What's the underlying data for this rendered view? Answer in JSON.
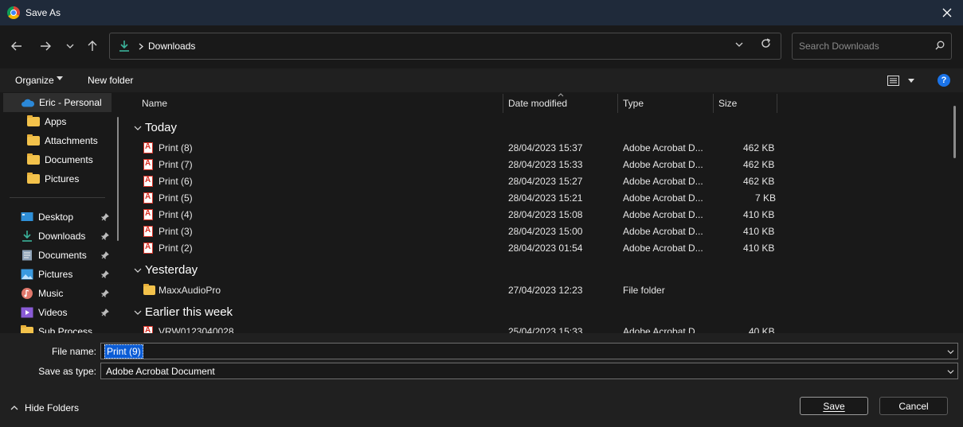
{
  "window": {
    "title": "Save As",
    "close_glyph": "✕"
  },
  "nav": {
    "back_icon": "arrow-left-icon",
    "forward_icon": "arrow-right-icon",
    "recent_icon": "chevron-down-icon",
    "up_icon": "arrow-up-icon",
    "breadcrumb": "Downloads",
    "search_placeholder": "Search Downloads"
  },
  "toolbar": {
    "organize": "Organize",
    "new_folder": "New folder",
    "help": "?"
  },
  "sidebar": {
    "onedrive": {
      "label": "Eric - Personal",
      "children": [
        "Apps",
        "Attachments",
        "Documents",
        "Pictures"
      ]
    },
    "quick_access": [
      {
        "label": "Desktop",
        "icon": "desktop-icon",
        "pinned": true
      },
      {
        "label": "Downloads",
        "icon": "downloads-icon",
        "pinned": true
      },
      {
        "label": "Documents",
        "icon": "documents-icon",
        "pinned": true
      },
      {
        "label": "Pictures",
        "icon": "pictures-icon",
        "pinned": true
      },
      {
        "label": "Music",
        "icon": "music-icon",
        "pinned": true
      },
      {
        "label": "Videos",
        "icon": "videos-icon",
        "pinned": true
      },
      {
        "label": "Sub Process",
        "icon": "folder-icon",
        "pinned": false
      }
    ]
  },
  "columns": {
    "name": "Name",
    "date": "Date modified",
    "type": "Type",
    "size": "Size"
  },
  "groups": [
    {
      "label": "Today",
      "rows": [
        {
          "name": "Print (8)",
          "date": "28/04/2023 15:37",
          "type": "Adobe Acrobat D...",
          "size": "462 KB",
          "icon": "pdf-icon"
        },
        {
          "name": "Print (7)",
          "date": "28/04/2023 15:33",
          "type": "Adobe Acrobat D...",
          "size": "462 KB",
          "icon": "pdf-icon"
        },
        {
          "name": "Print (6)",
          "date": "28/04/2023 15:27",
          "type": "Adobe Acrobat D...",
          "size": "462 KB",
          "icon": "pdf-icon"
        },
        {
          "name": "Print (5)",
          "date": "28/04/2023 15:21",
          "type": "Adobe Acrobat D...",
          "size": "7 KB",
          "icon": "pdf-icon"
        },
        {
          "name": "Print (4)",
          "date": "28/04/2023 15:08",
          "type": "Adobe Acrobat D...",
          "size": "410 KB",
          "icon": "pdf-icon"
        },
        {
          "name": "Print (3)",
          "date": "28/04/2023 15:00",
          "type": "Adobe Acrobat D...",
          "size": "410 KB",
          "icon": "pdf-icon"
        },
        {
          "name": "Print (2)",
          "date": "28/04/2023 01:54",
          "type": "Adobe Acrobat D...",
          "size": "410 KB",
          "icon": "pdf-icon"
        }
      ]
    },
    {
      "label": "Yesterday",
      "rows": [
        {
          "name": "MaxxAudioPro",
          "date": "27/04/2023 12:23",
          "type": "File folder",
          "size": "",
          "icon": "folder-icon"
        }
      ]
    },
    {
      "label": "Earlier this week",
      "rows": [
        {
          "name": "VRW0123040028",
          "date": "25/04/2023 15:33",
          "type": "Adobe Acrobat D...",
          "size": "40 KB",
          "icon": "pdf-icon"
        }
      ]
    }
  ],
  "form": {
    "file_name_label": "File name:",
    "file_name_value": "Print (9)",
    "save_type_label": "Save as type:",
    "save_type_value": "Adobe Acrobat Document"
  },
  "footer": {
    "hide_folders": "Hide Folders",
    "save": "Save",
    "cancel": "Cancel"
  },
  "colors": {
    "accent": "#0b5cd5",
    "help_blue": "#1a73e8",
    "folder": "#f3c24b",
    "pdf_red": "#d93025",
    "downloads_green": "#3bb39b"
  }
}
